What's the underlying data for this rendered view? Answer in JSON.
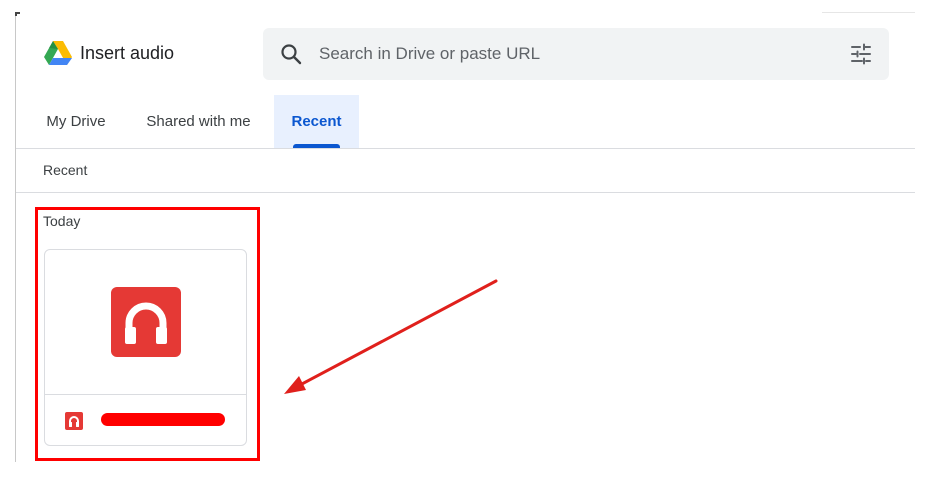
{
  "header": {
    "title": "Insert audio",
    "logo_icon": "google-drive-logo"
  },
  "search": {
    "placeholder": "Search in Drive or paste URL",
    "value": "",
    "search_icon": "search-icon",
    "options_icon": "search-options-icon"
  },
  "tabs": [
    {
      "label": "My Drive",
      "selected": false
    },
    {
      "label": "Shared with me",
      "selected": false
    },
    {
      "label": "Recent",
      "selected": true
    }
  ],
  "breadcrumb": "Recent",
  "sections": [
    {
      "label": "Today",
      "files": [
        {
          "name": "",
          "name_redacted": true,
          "type_icon": "audio-file-icon"
        }
      ]
    }
  ],
  "annotations": {
    "highlight_color": "#ff0000",
    "arrow_color": "#e0201c"
  },
  "colors": {
    "accent": "#0b57d0",
    "selected_tab_bg": "#e8f0fe",
    "audio_icon": "#e53935"
  }
}
